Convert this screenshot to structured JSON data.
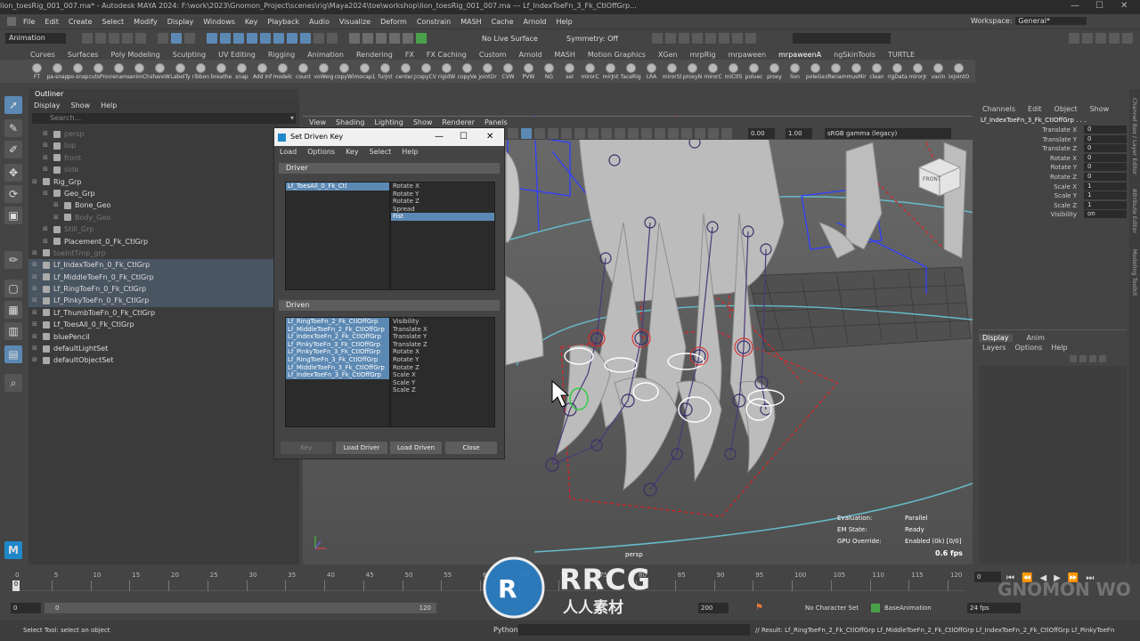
{
  "titlebar": {
    "title": "lion_toesRig_001_007.ma* - Autodesk MAYA 2024: F:\\work\\2023\\Gnomon_Project\\scenes\\rig\\Maya2024\\toe\\workshop\\lion_toesRig_001_007.ma  ---   Lf_IndexToeFn_3_Fk_CtlOffGrp...",
    "minimize": "—",
    "maximize": "☐",
    "close": "✕"
  },
  "menubar": {
    "items": [
      "File",
      "Edit",
      "Create",
      "Select",
      "Modify",
      "Display",
      "Windows",
      "Key",
      "Playback",
      "Audio",
      "Visualize",
      "Deform",
      "Constrain",
      "MASH",
      "Cache",
      "Arnold",
      "Help"
    ],
    "workspace_label": "Workspace:",
    "workspace_value": "General*"
  },
  "statusline": {
    "mode": "Animation",
    "live_surface": "No Live Surface",
    "symmetry": "Symmetry: Off"
  },
  "shelf": {
    "tabs": [
      "Curves",
      "Surfaces",
      "Poly Modeling",
      "Sculpting",
      "UV Editing",
      "Rigging",
      "Animation",
      "Rendering",
      "FX",
      "FX Caching",
      "Custom",
      "Arnold",
      "MASH",
      "Motion Graphics",
      "XGen",
      "mrpRig",
      "mrpaween",
      "mrpaweenA",
      "ngSkinTools",
      "TURTLE"
    ],
    "active_tab": "mrpaweenA",
    "items": [
      "FT",
      "pa-snap",
      "po-snap",
      "cutsPro",
      "xrename",
      "animCh",
      "shareW",
      "LabelTy",
      "ribbon",
      "breathe",
      "snap",
      "Add Inf",
      "modelc",
      "count",
      "voWeig",
      "copyWi",
      "mocap1",
      "furJnt",
      "center.J",
      "copyCV",
      "rigidW",
      "copyVe",
      "jointOr",
      "CVW",
      "PVW",
      "NG",
      "sel",
      "mirorC",
      "mirJnt",
      "faceRig",
      "LRA",
      "mirorSl",
      "proxyN",
      "mirorC",
      "miCtlS",
      "polvec",
      "proxy",
      "lion",
      "poleGe",
      "zRenam",
      "musMir",
      "clean",
      "rigData",
      "mirorJr",
      "vacin",
      "DxjointOr"
    ]
  },
  "outliner": {
    "title": "Outliner",
    "menu": [
      "Display",
      "Show",
      "Help"
    ],
    "search_placeholder": "Search...",
    "items": [
      {
        "label": "persp",
        "indent": 1,
        "dim": true
      },
      {
        "label": "top",
        "indent": 1,
        "dim": true
      },
      {
        "label": "front",
        "indent": 1,
        "dim": true
      },
      {
        "label": "side",
        "indent": 1,
        "dim": true
      },
      {
        "label": "Rig_Grp",
        "indent": 0,
        "dim": false
      },
      {
        "label": "Geo_Grp",
        "indent": 1,
        "dim": false
      },
      {
        "label": "Bone_Geo",
        "indent": 2,
        "dim": false
      },
      {
        "label": "Body_Geo",
        "indent": 2,
        "dim": true
      },
      {
        "label": "Still_Grp",
        "indent": 1,
        "dim": true
      },
      {
        "label": "Placement_0_Fk_CtlGrp",
        "indent": 1,
        "dim": false
      },
      {
        "label": "toeIntTmp_grp",
        "indent": 0,
        "dim": true
      },
      {
        "label": "Lf_IndexToeFn_0_Fk_CtlGrp",
        "indent": 0,
        "dim": false,
        "hl": true
      },
      {
        "label": "Lf_MiddleToeFn_0_Fk_CtlGrp",
        "indent": 0,
        "dim": false,
        "hl": true
      },
      {
        "label": "Lf_RingToeFn_0_Fk_CtlGrp",
        "indent": 0,
        "dim": false,
        "hl": true
      },
      {
        "label": "Lf_PinkyToeFn_0_Fk_CtlGrp",
        "indent": 0,
        "dim": false,
        "hl": true
      },
      {
        "label": "Lf_ThumbToeFn_0_Fk_CtlGrp",
        "indent": 0,
        "dim": false
      },
      {
        "label": "Lf_ToesAll_0_Fk_CtlGrp",
        "indent": 0,
        "dim": false
      },
      {
        "label": "bluePencil",
        "indent": 0,
        "dim": false
      },
      {
        "label": "defaultLightSet",
        "indent": 0,
        "dim": false
      },
      {
        "label": "defaultObjectSet",
        "indent": 0,
        "dim": false
      }
    ]
  },
  "sdk": {
    "title": "Set Driven Key",
    "menu": [
      "Load",
      "Options",
      "Key",
      "Select",
      "Help"
    ],
    "driver_label": "Driver",
    "driver_objects": [
      "Lf_ToesAll_0_Fk_Ctl"
    ],
    "driver_attrs": [
      "Rotate X",
      "Rotate Y",
      "Rotate Z",
      "Spread",
      "Fist"
    ],
    "driver_attr_selected": 4,
    "driven_label": "Driven",
    "driven_objects": [
      "Lf_RingToeFn_2_Fk_CtlOffGrp",
      "Lf_MiddleToeFn_2_Fk_CtlOffGrp",
      "Lf_IndexToeFn_2_Fk_CtlOffGrp",
      "Lf_PinkyToeFn_3_Fk_CtlOffGrp",
      "Lf_PinkyToeFn_3_Fk_CtlOffGrp",
      "Lf_RingToeFn_3_Fk_CtlOffGrp",
      "Lf_MiddleToeFn_3_Fk_CtlOffGrp",
      "Lf_IndexToeFn_3_Fk_CtlOffGrp"
    ],
    "driven_attrs": [
      "Visibility",
      "Translate X",
      "Translate Y",
      "Translate Z",
      "Rotate X",
      "Rotate Y",
      "Rotate Z",
      "Scale X",
      "Scale Y",
      "Scale Z"
    ],
    "buttons": {
      "key": "Key",
      "load_driver": "Load Driver",
      "load_driven": "Load Driven",
      "close": "Close"
    }
  },
  "viewport": {
    "menu": [
      "View",
      "Shading",
      "Lighting",
      "Show",
      "Renderer",
      "Panels"
    ],
    "exposure": "0.00",
    "gamma": "1.00",
    "color_space": "sRGB gamma (legacy)",
    "camera_label": "persp",
    "cube_label": "FRONT",
    "hud": {
      "evaluation_key": "Evaluation:",
      "evaluation_val": "Parallel",
      "em_key": "EM State:",
      "em_val": "Ready",
      "gpu_key": "GPU Override:",
      "gpu_val": "Enabled (0k) [0/0]",
      "fps": "0.6 fps"
    }
  },
  "channelbox": {
    "menu": [
      "Channels",
      "Edit",
      "Object",
      "Show"
    ],
    "object_name": "Lf_IndexToeFn_3_Fk_CtlOffGrp . . .",
    "channels": [
      {
        "name": "Translate X",
        "value": "0"
      },
      {
        "name": "Translate Y",
        "value": "0"
      },
      {
        "name": "Translate Z",
        "value": "0"
      },
      {
        "name": "Rotate X",
        "value": "0"
      },
      {
        "name": "Rotate Y",
        "value": "0"
      },
      {
        "name": "Rotate Z",
        "value": "0"
      },
      {
        "name": "Scale X",
        "value": "1"
      },
      {
        "name": "Scale Y",
        "value": "1"
      },
      {
        "name": "Scale Z",
        "value": "1"
      },
      {
        "name": "Visibility",
        "value": "on"
      }
    ],
    "side_tabs": [
      "Channel Box / Layer Editor",
      "Attribute Editor",
      "Modeling Toolkit"
    ]
  },
  "layereditor": {
    "tabs": [
      "Display",
      "Anim"
    ],
    "menu": [
      "Layers",
      "Options",
      "Help"
    ]
  },
  "timeline": {
    "ticks": [
      "0",
      "5",
      "10",
      "15",
      "20",
      "25",
      "30",
      "35",
      "40",
      "45",
      "50",
      "55",
      "60",
      "65",
      "70",
      "75",
      "80",
      "85",
      "90",
      "95",
      "100",
      "105",
      "110",
      "115",
      "120"
    ],
    "current_frame": "0",
    "right_frame": "0"
  },
  "range": {
    "start": "0",
    "inner_start": "0",
    "inner_end": "120",
    "end": "200",
    "character_set": "No Character Set",
    "anim_layer": "BaseAnimation",
    "fps": "24 fps"
  },
  "cmdline": {
    "help_text": "Select Tool: select an object",
    "language": "Python",
    "result": "// Result: Lf_RingToeFn_2_Fk_CtlOffGrp Lf_MiddleToeFn_2_Fk_CtlOffGrp Lf_IndexToeFn_2_Fk_CtlOffGrp Lf_PinkyToeFn"
  },
  "watermark": {
    "brand": "RRCG",
    "sub": "人人素材",
    "gnomon": "GNOMON WORKSHOP"
  },
  "colors": {
    "accent": "#5c89b3",
    "rig_red": "#e02020",
    "rig_blue": "#3040ff",
    "window_bg": "#444444"
  }
}
